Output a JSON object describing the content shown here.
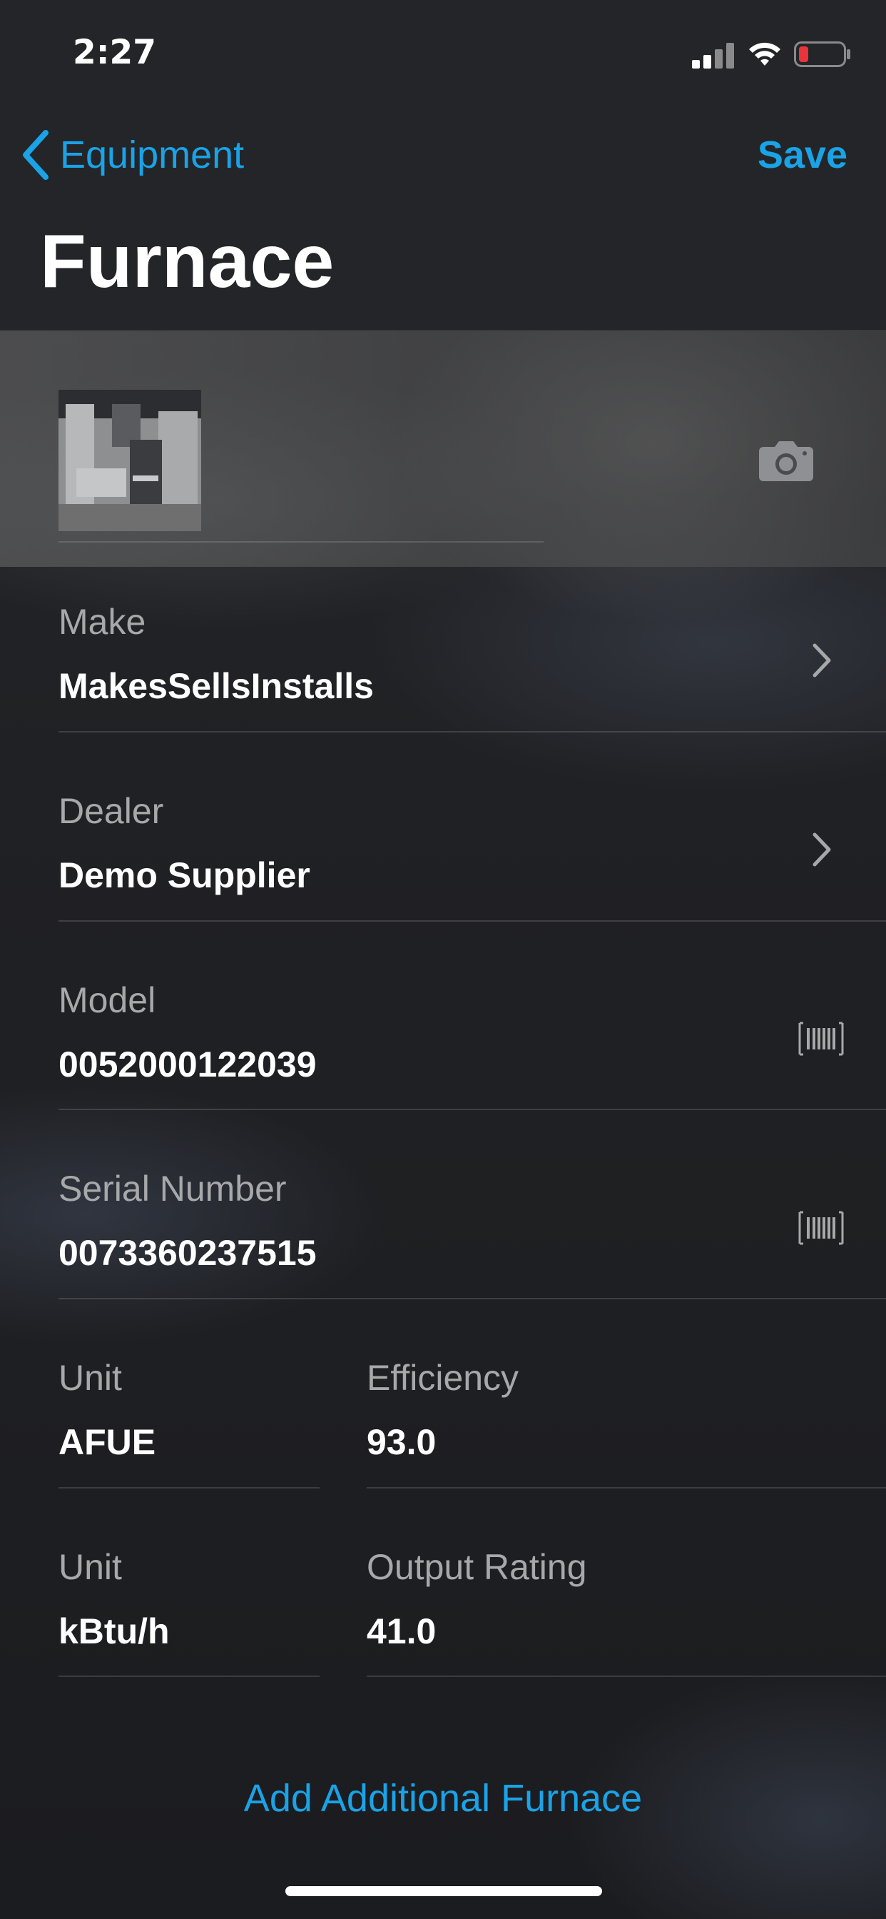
{
  "status_bar": {
    "time": "2:27"
  },
  "nav": {
    "back_label": "Equipment",
    "save_label": "Save",
    "title": "Furnace"
  },
  "fields": {
    "make": {
      "label": "Make",
      "value": "MakesSellsInstalls"
    },
    "dealer": {
      "label": "Dealer",
      "value": "Demo Supplier"
    },
    "model": {
      "label": "Model",
      "value": "0052000122039"
    },
    "serial": {
      "label": "Serial Number",
      "value": "0073360237515"
    },
    "efficiency_unit": {
      "label": "Unit",
      "value": "AFUE"
    },
    "efficiency": {
      "label": "Efficiency",
      "value": "93.0"
    },
    "output_unit": {
      "label": "Unit",
      "value": "kBtu/h"
    },
    "output_rating": {
      "label": "Output Rating",
      "value": "41.0"
    }
  },
  "actions": {
    "add_additional": "Add Additional Furnace"
  },
  "colors": {
    "accent": "#1aa3e6",
    "battery_low": "#e8343a"
  },
  "icons": [
    "chevron-left-icon",
    "camera-icon",
    "chevron-right-icon",
    "barcode-icon",
    "signal-icon",
    "wifi-icon",
    "battery-icon"
  ]
}
